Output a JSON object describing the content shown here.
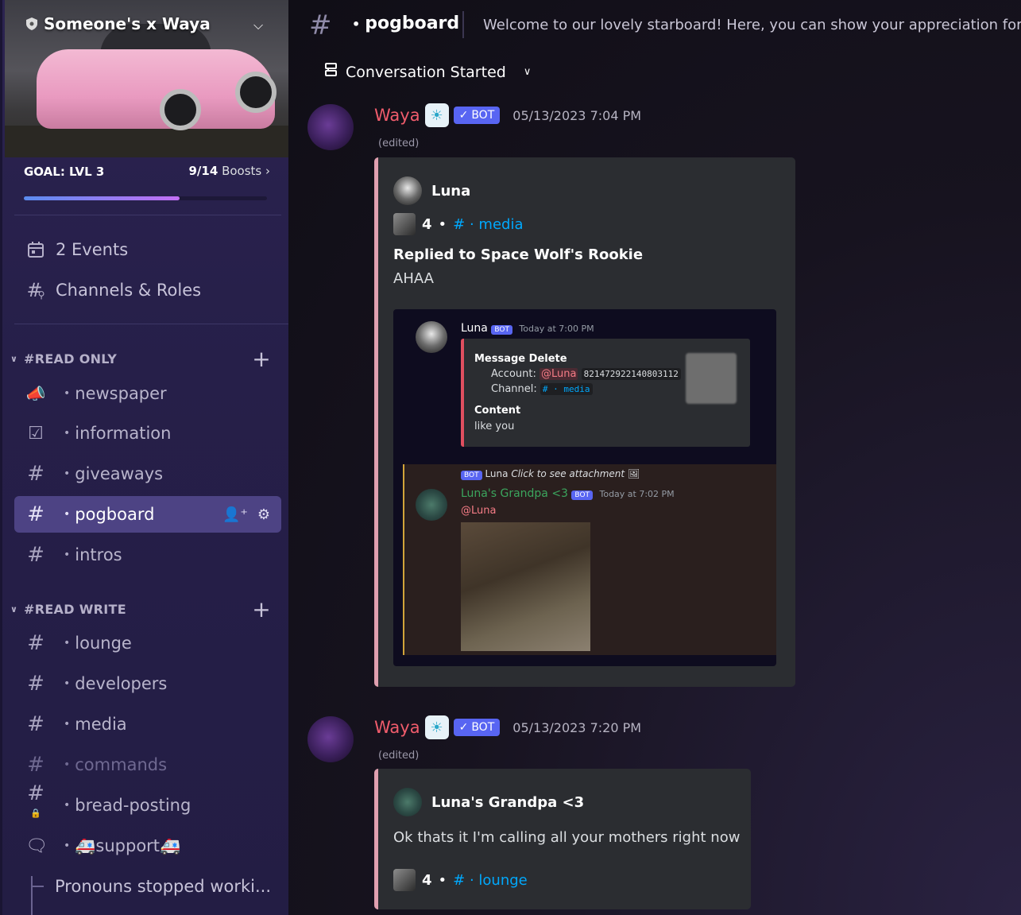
{
  "server": {
    "name": "Someone's x Waya",
    "boost_goal": "GOAL: LVL 3",
    "boost_count": "9/14",
    "boost_suffix": "Boosts",
    "boost_progress": 0.64
  },
  "sidebar": {
    "events_label": "2 Events",
    "channels_roles_label": "Channels & Roles",
    "categories": [
      {
        "name": "#READ ONLY",
        "channels": [
          {
            "name": "newspaper",
            "icon": "announcement-icon"
          },
          {
            "name": "information",
            "icon": "rules-icon"
          },
          {
            "name": "giveaways",
            "icon": "hash-icon"
          },
          {
            "name": "pogboard",
            "icon": "hash-icon",
            "active": true
          },
          {
            "name": "intros",
            "icon": "hash-icon"
          }
        ]
      },
      {
        "name": "#READ WRITE",
        "channels": [
          {
            "name": "lounge",
            "icon": "hash-icon"
          },
          {
            "name": "developers",
            "icon": "hash-icon"
          },
          {
            "name": "media",
            "icon": "hash-icon"
          },
          {
            "name": "commands",
            "icon": "hash-icon",
            "muted": true
          },
          {
            "name": "bread-posting",
            "icon": "locked-hash-icon"
          },
          {
            "name": "🚑support🚑",
            "icon": "forum-icon"
          }
        ]
      }
    ],
    "thread_label": "Pronouns stopped worki..."
  },
  "header": {
    "channel": "pogboard",
    "topic": "Welcome to our lovely starboard! Here, you can show your appreciation for r"
  },
  "thread_filter": "Conversation Started",
  "messages": [
    {
      "author": "Waya",
      "bot_label": "BOT",
      "timestamp": "05/13/2023 7:04 PM",
      "edited": "(edited)",
      "embed": {
        "author": "Luna",
        "stars": "4",
        "channel": "media",
        "reply_title": "Replied to Space Wolf's Rookie",
        "body": "AHAA",
        "screenshot": {
          "top_author": "Luna",
          "top_badge": "BOT",
          "top_time": "Today at 7:00 PM",
          "card_title": "Message Delete",
          "account_label": "Account:",
          "account_mention": "@Luna",
          "account_id": "821472922140803112",
          "channel_label": "Channel:",
          "channel_value": "# · media",
          "content_label": "Content",
          "content_value": "like you",
          "reply_badge": "BOT",
          "reply_author": "Luna",
          "reply_text": "Click to see attachment",
          "grandpa_name": "Luna's Grandpa <3",
          "grandpa_badge": "BOT",
          "grandpa_time": "Today at 7:02 PM",
          "grandpa_mention": "@Luna"
        }
      }
    },
    {
      "author": "Waya",
      "bot_label": "BOT",
      "timestamp": "05/13/2023 7:20 PM",
      "edited": "(edited)",
      "embed": {
        "author": "Luna's Grandpa <3",
        "body": "Ok thats it I'm calling all your mothers right now",
        "stars": "4",
        "channel": "lounge"
      }
    }
  ],
  "colors": {
    "accent": "#5865f2",
    "author": "#f05c6c",
    "link": "#00a8fc",
    "embed_border": "#e0a0b0",
    "active_channel": "#4d4384"
  }
}
